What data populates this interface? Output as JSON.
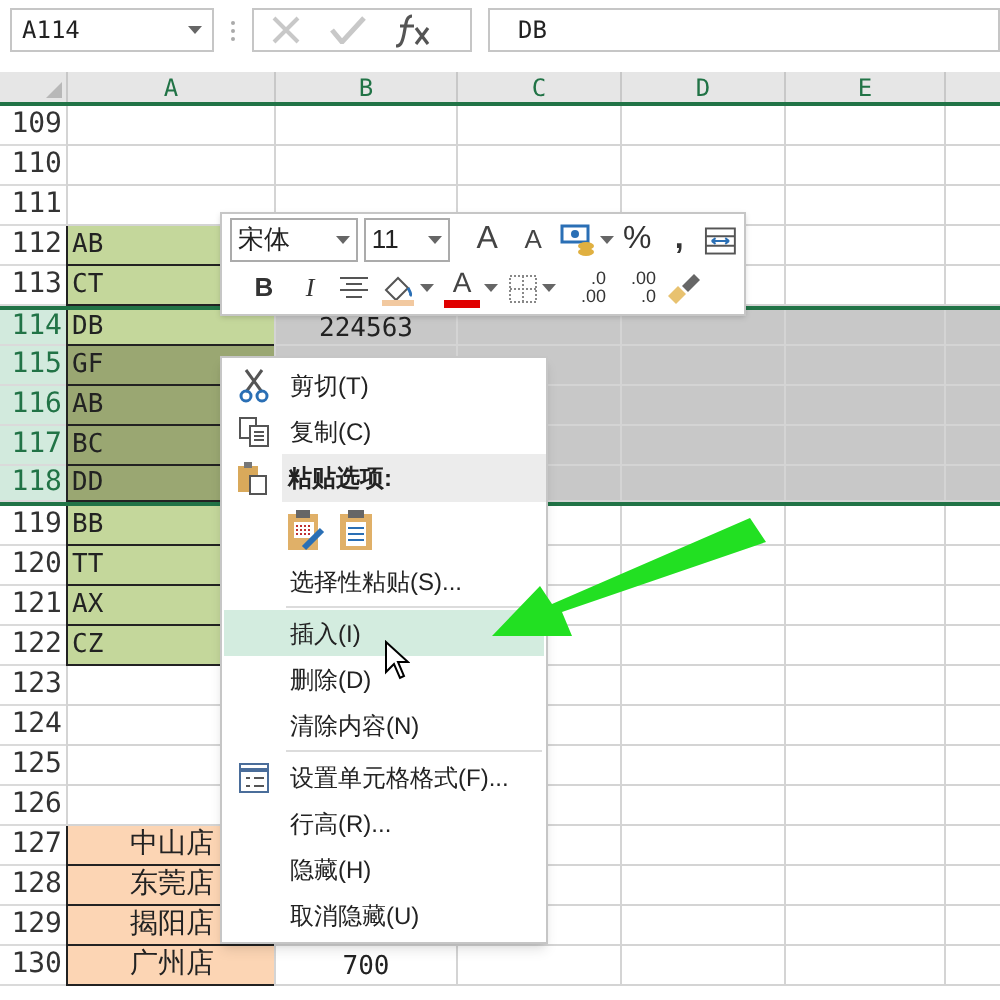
{
  "name_box": {
    "value": "A114"
  },
  "formula_bar": {
    "value": "DB"
  },
  "columns": [
    "A",
    "B",
    "C",
    "D",
    "E"
  ],
  "rows": [
    {
      "number": "109",
      "selected": false,
      "cells": [
        {},
        {},
        {},
        {},
        {}
      ]
    },
    {
      "number": "110",
      "selected": false,
      "cells": [
        {},
        {},
        {},
        {},
        {}
      ]
    },
    {
      "number": "111",
      "selected": false,
      "cells": [
        {},
        {},
        {},
        {},
        {}
      ]
    },
    {
      "number": "112",
      "selected": false,
      "cells": [
        {
          "text": "AB",
          "color": "#c4d79b"
        },
        {},
        {},
        {},
        {}
      ]
    },
    {
      "number": "113",
      "selected": false,
      "cells": [
        {
          "text": "CT",
          "color": "#c4d79b"
        },
        {},
        {},
        {},
        {}
      ]
    },
    {
      "number": "114",
      "selected": true,
      "cells": [
        {
          "text": "DB",
          "color": "#c4d79b"
        },
        {
          "text": "224563",
          "kind": "number"
        },
        {},
        {},
        {}
      ]
    },
    {
      "number": "115",
      "selected": true,
      "cells": [
        {
          "text": "GF",
          "color": "#9aa772"
        },
        {},
        {},
        {},
        {}
      ]
    },
    {
      "number": "116",
      "selected": true,
      "cells": [
        {
          "text": "AB",
          "color": "#9aa772"
        },
        {},
        {},
        {},
        {}
      ]
    },
    {
      "number": "117",
      "selected": true,
      "cells": [
        {
          "text": "BC",
          "color": "#9aa772"
        },
        {},
        {},
        {},
        {}
      ]
    },
    {
      "number": "118",
      "selected": true,
      "cells": [
        {
          "text": "DD",
          "color": "#9aa772"
        },
        {},
        {},
        {},
        {}
      ]
    },
    {
      "number": "119",
      "selected": false,
      "cells": [
        {
          "text": "BB",
          "color": "#c4d79b"
        },
        {},
        {},
        {},
        {}
      ]
    },
    {
      "number": "120",
      "selected": false,
      "cells": [
        {
          "text": "TT",
          "color": "#c4d79b"
        },
        {},
        {},
        {},
        {}
      ]
    },
    {
      "number": "121",
      "selected": false,
      "cells": [
        {
          "text": "AX",
          "color": "#c4d79b"
        },
        {},
        {},
        {},
        {}
      ]
    },
    {
      "number": "122",
      "selected": false,
      "cells": [
        {
          "text": "CZ",
          "color": "#c4d79b"
        },
        {},
        {},
        {},
        {}
      ]
    },
    {
      "number": "123",
      "selected": false,
      "cells": [
        {},
        {},
        {},
        {},
        {}
      ]
    },
    {
      "number": "124",
      "selected": false,
      "cells": [
        {},
        {},
        {},
        {},
        {}
      ]
    },
    {
      "number": "125",
      "selected": false,
      "cells": [
        {},
        {},
        {},
        {},
        {}
      ]
    },
    {
      "number": "126",
      "selected": false,
      "cells": [
        {},
        {},
        {},
        {},
        {}
      ]
    },
    {
      "number": "127",
      "selected": false,
      "cells": [
        {
          "text": "中山店",
          "kind": "name",
          "color": "#fcd5b4"
        },
        {},
        {},
        {},
        {}
      ]
    },
    {
      "number": "128",
      "selected": false,
      "cells": [
        {
          "text": "东莞店",
          "kind": "name",
          "color": "#fcd5b4"
        },
        {},
        {},
        {},
        {}
      ]
    },
    {
      "number": "129",
      "selected": false,
      "cells": [
        {
          "text": "揭阳店",
          "kind": "name",
          "color": "#fcd5b4"
        },
        {},
        {},
        {},
        {}
      ]
    },
    {
      "number": "130",
      "selected": false,
      "cells": [
        {
          "text": "广州店",
          "kind": "name",
          "color": "#fcd5b4"
        },
        {
          "text": "700",
          "kind": "number"
        },
        {},
        {},
        {}
      ]
    }
  ],
  "mini_toolbar": {
    "font": "宋体",
    "size": "11",
    "row_1": [
      {
        "kind": "grow",
        "label": "A"
      },
      {
        "kind": "shrink",
        "label": "A"
      },
      {
        "kind": "currency"
      },
      {
        "kind": "percent",
        "label": "%"
      },
      {
        "kind": "comma",
        "label": ","
      },
      {
        "kind": "wrap"
      }
    ],
    "row_2": [
      {
        "kind": "bold",
        "label": "B"
      },
      {
        "kind": "italic",
        "label": "I"
      },
      {
        "kind": "align"
      },
      {
        "kind": "fill"
      },
      {
        "kind": "font-color",
        "label": "A"
      },
      {
        "kind": "borders"
      },
      {
        "kind": "decimal",
        "label": ".0",
        "sub": ".00"
      },
      {
        "kind": "decimal",
        "label": ".00",
        "sub": ".0"
      },
      {
        "kind": "brush"
      }
    ]
  },
  "context_menu": [
    {
      "kind": "cut",
      "label": "剪切(T)",
      "selected": false
    },
    {
      "kind": "copy",
      "label": "复制(C)",
      "selected": false
    },
    {
      "kind": "header",
      "label": "粘贴选项:"
    },
    {
      "kind": "paste-icons"
    },
    {
      "kind": "item",
      "label": "选择性粘贴(S)...",
      "selected": false
    },
    {
      "kind": "separator"
    },
    {
      "kind": "item",
      "label": "插入(I)",
      "selected": true
    },
    {
      "kind": "item",
      "label": "删除(D)",
      "selected": false
    },
    {
      "kind": "item",
      "label": "清除内容(N)",
      "selected": false
    },
    {
      "kind": "separator"
    },
    {
      "kind": "format",
      "label": "设置单元格格式(F)...",
      "selected": false
    },
    {
      "kind": "item",
      "label": "行高(R)...",
      "selected": false
    },
    {
      "kind": "item",
      "label": "隐藏(H)",
      "selected": false
    },
    {
      "kind": "item",
      "label": "取消隐藏(U)",
      "selected": false
    }
  ]
}
